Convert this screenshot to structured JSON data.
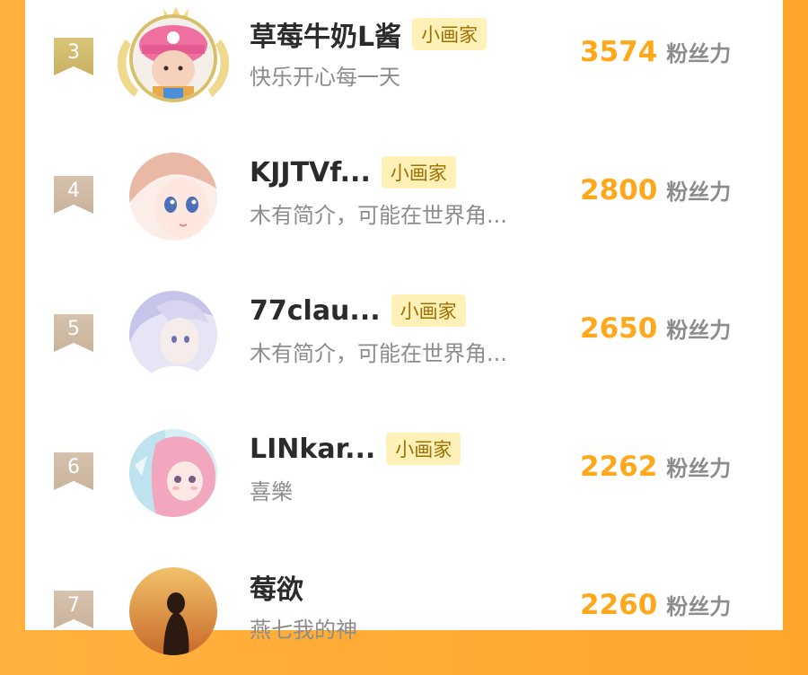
{
  "leaderboard": {
    "rows": [
      {
        "rank": "3",
        "name": "草莓牛奶L酱",
        "badge": "小画家",
        "bio": "快乐开心每一天",
        "score": "3574",
        "unit": "粉丝力",
        "avatar": "child-in-pink-hat-avatar",
        "flag_color": "#d0bc6e"
      },
      {
        "rank": "4",
        "name": "KJJTVf...",
        "badge": "小画家",
        "bio": "木有简介，可能在世界角...",
        "score": "2800",
        "unit": "粉丝力",
        "avatar": "anime-girl-avatar",
        "flag_color": "#cfb9a2"
      },
      {
        "rank": "5",
        "name": "77clau...",
        "badge": "小画家",
        "bio": "木有简介，可能在世界角...",
        "score": "2650",
        "unit": "粉丝力",
        "avatar": "anime-boy-avatar",
        "flag_color": "#cfb9a2"
      },
      {
        "rank": "6",
        "name": "LINkar...",
        "badge": "小画家",
        "bio": "喜樂",
        "score": "2262",
        "unit": "粉丝力",
        "avatar": "pink-hair-girl-avatar",
        "flag_color": "#cfb9a2"
      },
      {
        "rank": "7",
        "name": "莓欲",
        "badge": "",
        "bio": "燕七我的神",
        "score": "2260",
        "unit": "粉丝力",
        "avatar": "sunset-silhouette-avatar",
        "flag_color": "#cfb9a2"
      }
    ]
  },
  "colors": {
    "background": "#ffa52c",
    "score": "#ffa81c",
    "badge_bg": "#fff1b8"
  }
}
